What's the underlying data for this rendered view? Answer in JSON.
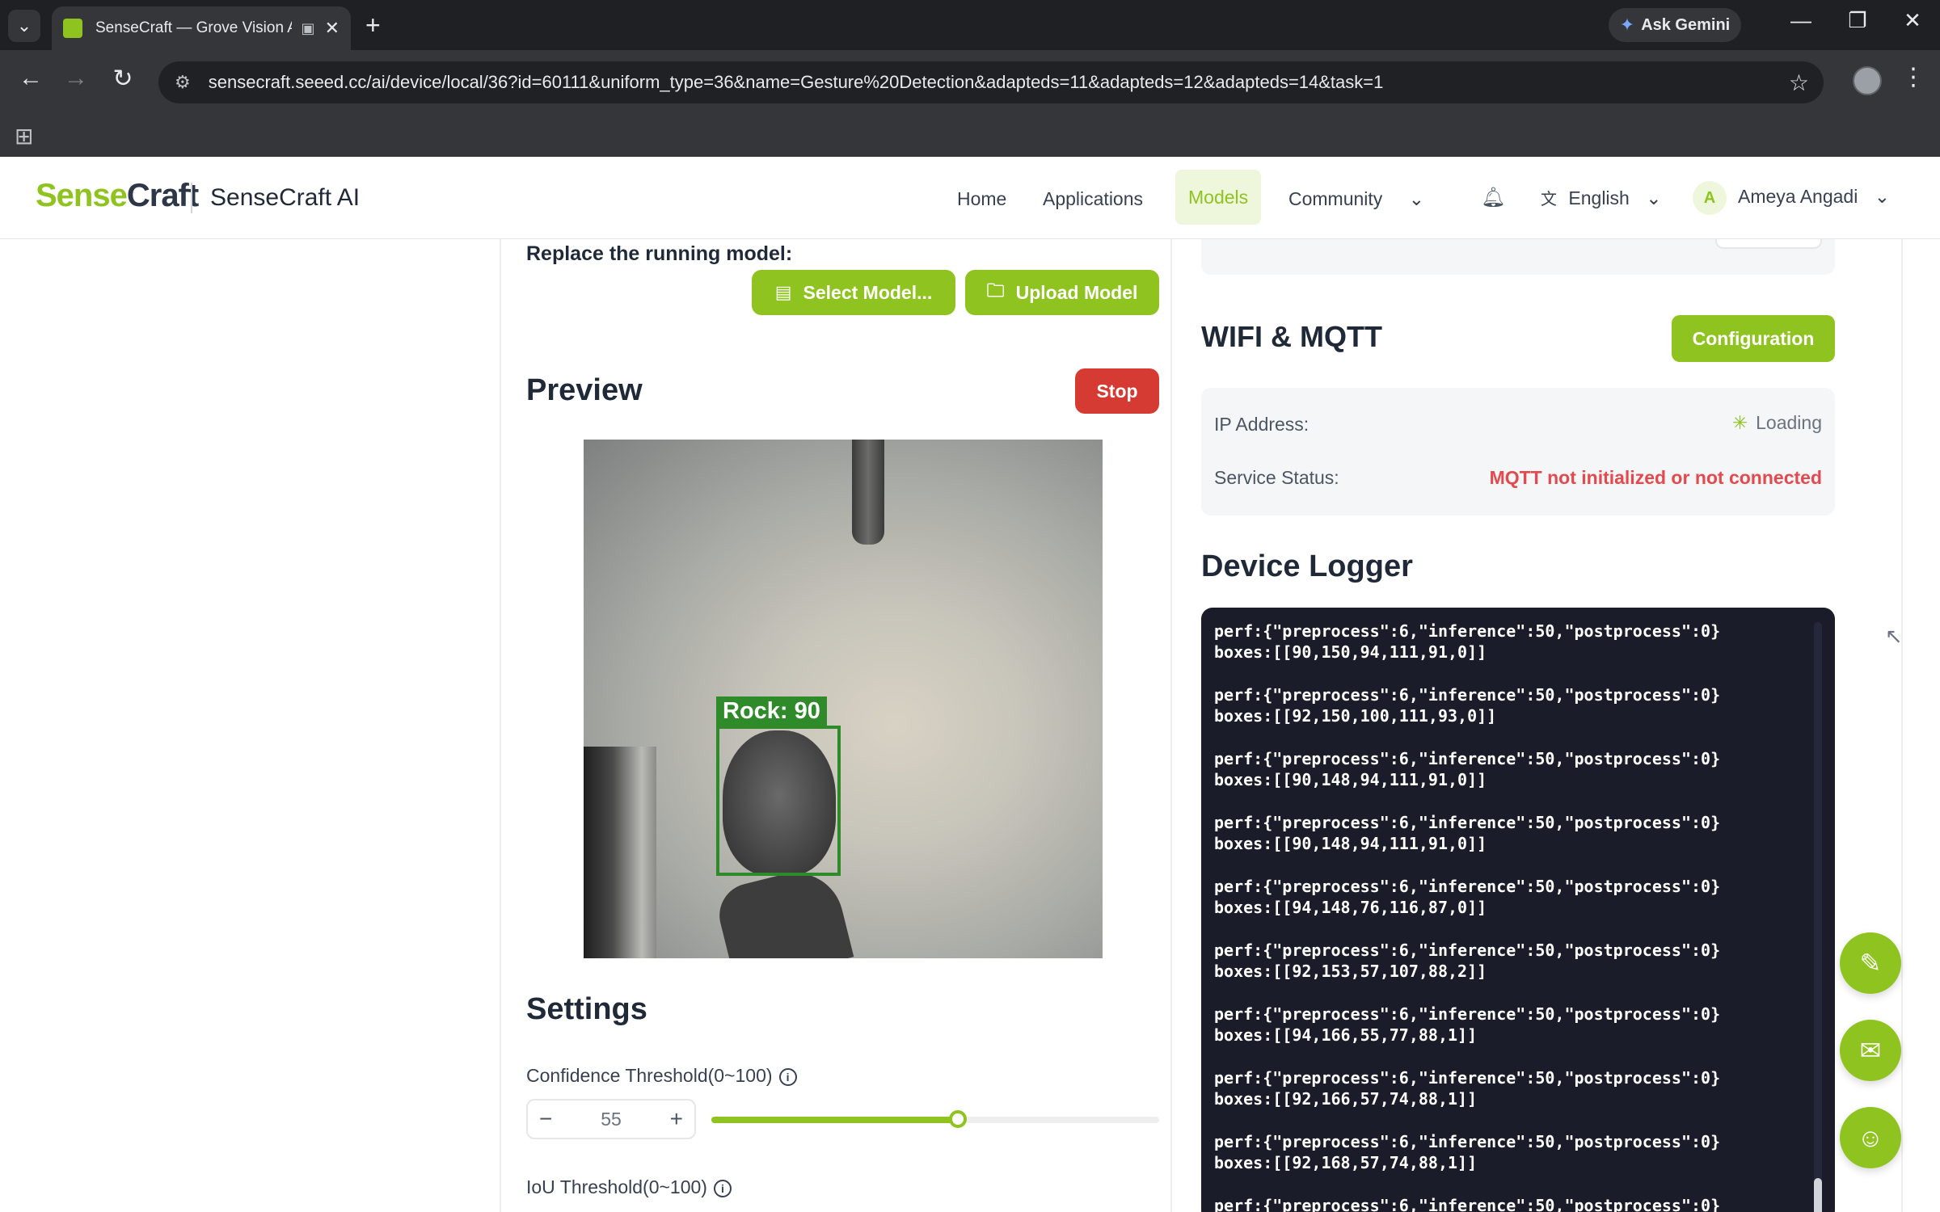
{
  "browser": {
    "tab_title": "SenseCraft — Grove Vision AI",
    "new_tab_glyph": "+",
    "ask_gemini": "Ask Gemini",
    "url": "sensecraft.seeed.cc/ai/device/local/36?id=60111&uniform_type=36&name=Gesture%20Detection&adapteds=11&adapteds=12&adapteds=14&task=1"
  },
  "header": {
    "logo_part1": "Sense",
    "logo_part2": "Craft",
    "product": "SenseCraft AI",
    "nav": [
      "Home",
      "Applications",
      "Models",
      "Community"
    ],
    "active_nav": "Models",
    "language": "English",
    "user_initial": "A",
    "user_name": "Ameya Angadi"
  },
  "model": {
    "replace_label": "Replace the running model:",
    "select_btn": "Select Model...",
    "upload_btn": "Upload Model"
  },
  "preview": {
    "title": "Preview",
    "stop_btn": "Stop",
    "detection_label": "Rock: 90"
  },
  "settings": {
    "title": "Settings",
    "confidence_label": "Confidence Threshold(0~100)",
    "confidence_value": "55",
    "confidence_fraction": 0.55,
    "iou_label": "IoU Threshold(0~100)",
    "minus": "−",
    "plus": "+"
  },
  "wifi": {
    "title": "WIFI & MQTT",
    "config_btn": "Configuration",
    "ip_label": "IP Address:",
    "ip_value": "Loading",
    "service_label": "Service Status:",
    "service_value": "MQTT not initialized or not connected"
  },
  "logger": {
    "title": "Device Logger",
    "entries": [
      "perf:{\"preprocess\":6,\"inference\":50,\"postprocess\":0}\nboxes:[[90,150,94,111,91,0]]",
      "perf:{\"preprocess\":6,\"inference\":50,\"postprocess\":0}\nboxes:[[92,150,100,111,93,0]]",
      "perf:{\"preprocess\":6,\"inference\":50,\"postprocess\":0}\nboxes:[[90,148,94,111,91,0]]",
      "perf:{\"preprocess\":6,\"inference\":50,\"postprocess\":0}\nboxes:[[90,148,94,111,91,0]]",
      "perf:{\"preprocess\":6,\"inference\":50,\"postprocess\":0}\nboxes:[[94,148,76,116,87,0]]",
      "perf:{\"preprocess\":6,\"inference\":50,\"postprocess\":0}\nboxes:[[92,153,57,107,88,2]]",
      "perf:{\"preprocess\":6,\"inference\":50,\"postprocess\":0}\nboxes:[[94,166,55,77,88,1]]",
      "perf:{\"preprocess\":6,\"inference\":50,\"postprocess\":0}\nboxes:[[92,166,57,74,88,1]]",
      "perf:{\"preprocess\":6,\"inference\":50,\"postprocess\":0}\nboxes:[[92,168,57,74,88,1]]",
      "perf:{\"preprocess\":6,\"inference\":50,\"postprocess\":0}"
    ]
  },
  "colors": {
    "brand_green": "#8fc31f",
    "stop_red": "#d63b33",
    "error_text": "#e5484d",
    "logger_bg": "#1a1d29"
  },
  "icons": {
    "tab_menu": "chevron-down-icon",
    "back": "arrow-left-icon",
    "forward": "arrow-right-icon",
    "reload": "reload-icon",
    "bookmark": "star-icon",
    "bell": "bell-icon",
    "language": "translate-icon",
    "fabs": [
      "tools-icon",
      "feedback-icon",
      "community-icon"
    ]
  }
}
